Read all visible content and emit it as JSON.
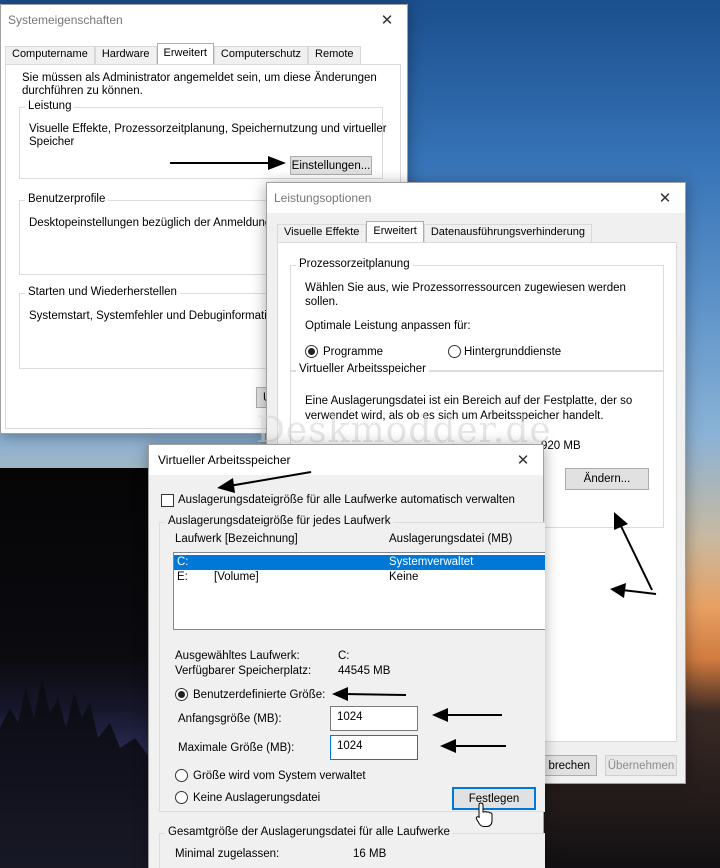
{
  "watermark": "Deskmodder.de",
  "system_properties": {
    "title": "Systemeigenschaften",
    "tabs": [
      "Computername",
      "Hardware",
      "Erweitert",
      "Computerschutz",
      "Remote"
    ],
    "active_tab": "Erweitert",
    "admin_note_1": "Sie müssen als Administrator angemeldet sein, um diese Änderungen",
    "admin_note_2": "durchführen zu können.",
    "leistung": {
      "title": "Leistung",
      "desc_1": "Visuelle Effekte, Prozessorzeitplanung, Speichernutzung und virtueller",
      "desc_2": "Speicher",
      "button": "Einstellungen..."
    },
    "benutzerprofile": {
      "title": "Benutzerprofile",
      "desc": "Desktopeinstellungen bezüglich der Anmeldung"
    },
    "starten": {
      "title": "Starten und Wiederherstellen",
      "desc": "Systemstart, Systemfehler und Debuginformationen"
    },
    "partial_button": "U"
  },
  "performance_options": {
    "title": "Leistungsoptionen",
    "tabs": [
      "Visuelle Effekte",
      "Erweitert",
      "Datenausführungsverhinderung"
    ],
    "active_tab": "Erweitert",
    "cpu": {
      "title": "Prozessorzeitplanung",
      "desc_1": "Wählen Sie aus, wie Prozessorressourcen zugewiesen werden",
      "desc_2": "sollen.",
      "optimal": "Optimale Leistung anpassen für:",
      "option_programs": "Programme",
      "option_background": "Hintergrunddienste"
    },
    "virtual_memory": {
      "title": "Virtueller Arbeitsspeicher",
      "desc_1": "Eine Auslagerungsdatei ist ein Bereich auf der Festplatte, der so",
      "desc_2": "verwendet wird, als ob es sich um Arbeitsspeicher handelt.",
      "size_partial": "920 MB",
      "change_button": "Ändern..."
    },
    "cancel_partial": "brechen",
    "apply_button": "Übernehmen"
  },
  "virtual_memory_dialog": {
    "title": "Virtueller Arbeitsspeicher",
    "auto_manage": "Auslagerungsdateigröße für alle Laufwerke automatisch verwalten",
    "per_drive_title": "Auslagerungsdateigröße für jedes Laufwerk",
    "col_drive": "Laufwerk [Bezeichnung]",
    "col_pagefile": "Auslagerungsdatei (MB)",
    "drives": [
      {
        "drive": "C:",
        "label": "",
        "pagefile": "Systemverwaltet"
      },
      {
        "drive": "E:",
        "label": "[Volume]",
        "pagefile": "Keine"
      }
    ],
    "selected_drive_label": "Ausgewähltes Laufwerk:",
    "selected_drive_value": "C:",
    "free_space_label": "Verfügbarer Speicherplatz:",
    "free_space_value": "44545 MB",
    "custom_size": "Benutzerdefinierte Größe:",
    "initial_size_label": "Anfangsgröße (MB):",
    "initial_size_value": "1024",
    "max_size_label": "Maximale Größe (MB):",
    "max_size_value": "1024",
    "system_managed": "Größe wird vom System verwaltet",
    "no_pagefile": "Keine Auslagerungsdatei",
    "set_button": "Festlegen",
    "total_title": "Gesamtgröße der Auslagerungsdatei für alle Laufwerke",
    "min_allowed_label": "Minimal zugelassen:",
    "min_allowed_value": "16 MB"
  }
}
